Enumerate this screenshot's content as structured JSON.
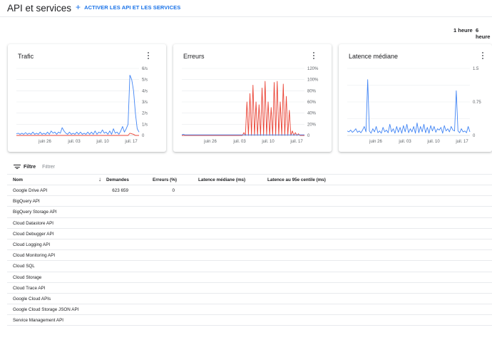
{
  "header": {
    "title": "API et services",
    "enable_label": "ACTIVER LES API ET LES SERVICES"
  },
  "time_range": {
    "options": [
      "1 heure",
      "6 heure"
    ]
  },
  "cards": {
    "traffic": {
      "title": "Trafic"
    },
    "errors": {
      "title": "Erreurs"
    },
    "latency": {
      "title": "Latence médiane"
    }
  },
  "chart_data": [
    {
      "type": "line",
      "title": "Trafic",
      "x_ticks": [
        "juin 26",
        "juil. 03",
        "juil. 10",
        "juil. 17"
      ],
      "y_ticks": [
        "0",
        "1/s",
        "2/s",
        "3/s",
        "4/s",
        "5/s",
        "6/s"
      ],
      "ylim": [
        0,
        6
      ],
      "grid": true,
      "series": [
        {
          "color": "#4285f4",
          "values": [
            0.15,
            0.2,
            0.1,
            0.2,
            0.1,
            0.25,
            0.1,
            0.2,
            0.1,
            0.3,
            0.1,
            0.2,
            0.1,
            0.3,
            0.1,
            0.2,
            0.1,
            0.3,
            0.1,
            0.4,
            0.2,
            0.3,
            0.1,
            0.3,
            0.2,
            0.7,
            0.4,
            0.2,
            0.1,
            0.3,
            0.1,
            0.2,
            0.1,
            0.3,
            0.1,
            0.3,
            0.1,
            0.2,
            0.1,
            0.3,
            0.1,
            0.3,
            0.1,
            0.4,
            0.1,
            0.3,
            0.2,
            0.5,
            0.2,
            0.3,
            0.1,
            0.4,
            0.1,
            0.6,
            0.2,
            0.3,
            0.1,
            0.4,
            0.8,
            0.3,
            0.6,
            1.0,
            5.4,
            5.0,
            4.0,
            2.0,
            0.6,
            0.3
          ]
        },
        {
          "color": "#ea4335",
          "values": [
            0,
            0,
            0,
            0,
            0,
            0,
            0,
            0,
            0,
            0,
            0,
            0,
            0,
            0,
            0,
            0,
            0,
            0,
            0,
            0,
            0,
            0,
            0,
            0,
            0,
            0,
            0,
            0,
            0,
            0,
            0,
            0,
            0,
            0,
            0,
            0,
            0,
            0,
            0,
            0,
            0,
            0,
            0,
            0,
            0,
            0,
            0,
            0,
            0,
            0,
            0,
            0,
            0,
            0,
            0,
            0,
            0,
            0,
            0,
            0,
            0,
            0,
            0.2,
            0.15,
            0.1,
            0,
            0,
            0
          ]
        }
      ]
    },
    {
      "type": "line",
      "title": "Erreurs",
      "x_ticks": [
        "juin 26",
        "juil. 03",
        "juil. 10",
        "juil. 17"
      ],
      "y_ticks": [
        "0",
        "20%",
        "40%",
        "60%",
        "80%",
        "100%",
        "120%"
      ],
      "ylim": [
        0,
        120
      ],
      "grid": true,
      "series": [
        {
          "color": "#ea4335",
          "values": [
            0,
            0,
            0,
            0,
            0,
            0,
            0,
            0,
            0,
            0,
            0,
            0,
            0,
            0,
            0,
            0,
            0,
            0,
            0,
            0,
            0,
            0,
            0,
            0,
            0,
            0,
            0,
            0,
            0,
            0,
            0,
            0,
            0,
            0,
            0,
            0,
            0,
            0,
            0,
            0,
            0,
            5,
            0,
            60,
            0,
            75,
            0,
            90,
            0,
            60,
            0,
            55,
            0,
            85,
            0,
            97,
            0,
            60,
            0,
            50,
            0,
            95,
            0,
            97,
            0,
            60,
            0,
            92,
            0,
            70,
            0,
            45,
            0,
            8,
            0,
            5,
            0,
            3,
            0,
            0,
            0,
            0
          ]
        },
        {
          "color": "#4285f4",
          "values": [
            1,
            2,
            1,
            1,
            1,
            1,
            1,
            1,
            1,
            1,
            1,
            1,
            1,
            1,
            1,
            1,
            1,
            1,
            1,
            1,
            1,
            1,
            1,
            1,
            1,
            1,
            1,
            1,
            1,
            1,
            1,
            1,
            1,
            1,
            1,
            1,
            1,
            1,
            1,
            1,
            1,
            1,
            1,
            1,
            1,
            1,
            1,
            1,
            1,
            1,
            1,
            1,
            1,
            1,
            1,
            1,
            1,
            1,
            1,
            1,
            1,
            1,
            1,
            1,
            1,
            1,
            1,
            1,
            1,
            1,
            1,
            1,
            1,
            1,
            1,
            1,
            1,
            1,
            1,
            1,
            1,
            1
          ]
        }
      ]
    },
    {
      "type": "line",
      "title": "Latence médiane",
      "x_ticks": [
        "juin 26",
        "juil. 03",
        "juil. 10",
        "juil. 17"
      ],
      "y_ticks": [
        "0",
        "0.75",
        "1.5"
      ],
      "ylim": [
        0,
        1.5
      ],
      "grid": true,
      "series": [
        {
          "color": "#4285f4",
          "values": [
            0.1,
            0.08,
            0.12,
            0.07,
            0.1,
            0.15,
            0.07,
            0.1,
            0.06,
            0.12,
            0.2,
            0.08,
            1.25,
            0.1,
            0.05,
            0.15,
            0.08,
            0.2,
            0.06,
            0.1,
            0.05,
            0.18,
            0.08,
            0.12,
            0.06,
            0.25,
            0.08,
            0.15,
            0.05,
            0.2,
            0.07,
            0.18,
            0.05,
            0.22,
            0.08,
            0.25,
            0.06,
            0.15,
            0.08,
            0.2,
            0.05,
            0.28,
            0.06,
            0.2,
            0.08,
            0.25,
            0.06,
            0.18,
            0.05,
            0.22,
            0.1,
            0.2,
            0.07,
            0.15,
            0.12,
            0.18,
            0.05,
            0.22,
            0.1,
            0.15,
            0.08,
            0.2,
            0.12,
            0.1,
            1.0,
            0.1,
            0.06,
            0.15,
            0.08,
            0.1,
            0.06,
            0.2,
            0.08
          ]
        }
      ]
    }
  ],
  "filter": {
    "label": "Filtre",
    "placeholder": "Filtrer"
  },
  "table": {
    "columns": [
      "Nom",
      "Demandes",
      "Erreurs (%)",
      "Latence médiane (ms)",
      "Latence au 95e centile (ms)"
    ],
    "sort_icon": "arrow-down-icon",
    "rows": [
      {
        "name": "Google Drive API",
        "requests": "623 659",
        "errors": "0"
      },
      {
        "name": "BigQuery API"
      },
      {
        "name": "BigQuery Storage API"
      },
      {
        "name": "Cloud Datastore API"
      },
      {
        "name": "Cloud Debugger API"
      },
      {
        "name": "Cloud Logging API"
      },
      {
        "name": "Cloud Monitoring API"
      },
      {
        "name": "Cloud SQL"
      },
      {
        "name": "Cloud Storage"
      },
      {
        "name": "Cloud Trace API"
      },
      {
        "name": "Google Cloud APIs"
      },
      {
        "name": "Google Cloud Storage JSON API"
      },
      {
        "name": "Service Management API"
      }
    ]
  },
  "colors": {
    "accent": "#1a73e8",
    "series_blue": "#4285f4",
    "series_red": "#ea4335"
  }
}
